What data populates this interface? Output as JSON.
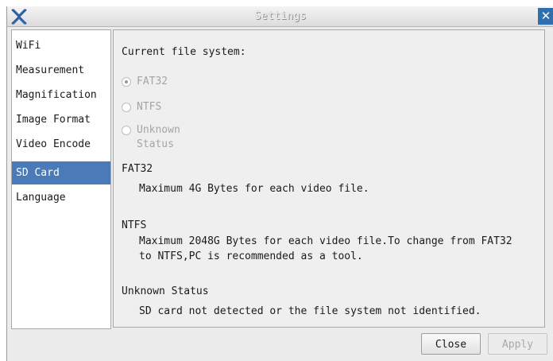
{
  "window": {
    "title": "Settings"
  },
  "sidebar": {
    "items": [
      {
        "label": "WiFi",
        "selected": false
      },
      {
        "label": "Measurement",
        "selected": false
      },
      {
        "label": "Magnification",
        "selected": false
      },
      {
        "label": "Image Format",
        "selected": false
      },
      {
        "label": "Video Encode",
        "selected": false
      },
      {
        "label": "SD Card",
        "selected": true
      },
      {
        "label": "Language",
        "selected": false
      }
    ]
  },
  "panel": {
    "heading": "Current file system:",
    "options": [
      {
        "label": "FAT32",
        "checked": true
      },
      {
        "label": "NTFS",
        "checked": false
      },
      {
        "label": "Unknown Status",
        "checked": false
      }
    ],
    "sections": [
      {
        "title": "FAT32",
        "lines": [
          "Maximum 4G Bytes for each video file."
        ]
      },
      {
        "title": "NTFS",
        "lines": [
          "Maximum 2048G Bytes for each video file.To change from FAT32",
          "to NTFS,PC is recommended as a tool."
        ]
      },
      {
        "title": "Unknown Status",
        "lines": [
          "SD card not detected or the file system not identified."
        ]
      }
    ]
  },
  "footer": {
    "close_label": "Close",
    "apply_label": "Apply"
  },
  "colors": {
    "selection": "#4b7ab8",
    "close_button": "#2f6fb0",
    "disabled_text": "#a4a4a4"
  },
  "icons": {
    "app": "x-logo-icon",
    "window_close": "close-icon"
  }
}
